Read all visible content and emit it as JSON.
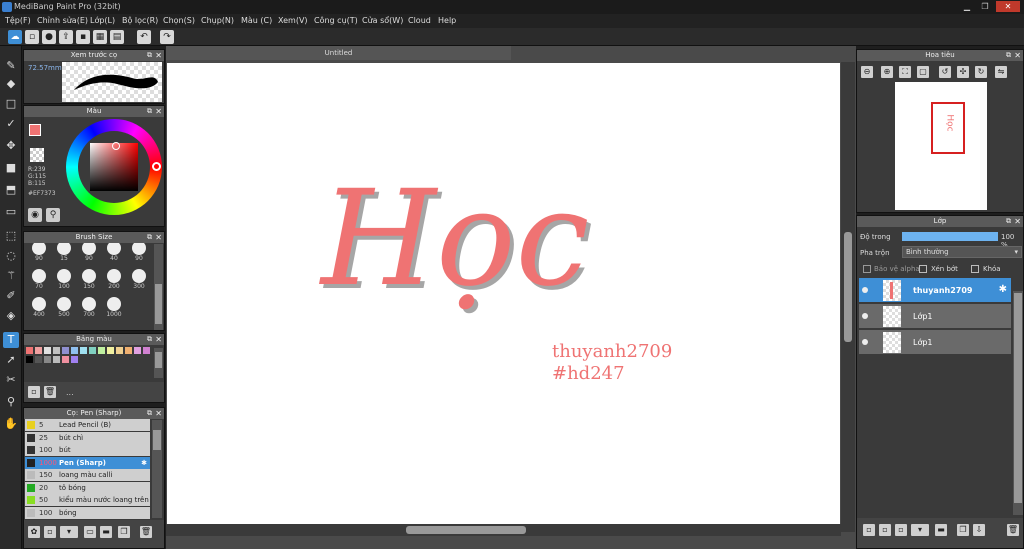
{
  "window": {
    "title": "MediBang Paint Pro (32bit)",
    "minimize": "▁",
    "maximize": "❐",
    "close": "✕"
  },
  "menu": [
    "Tệp(F)",
    "Chỉnh sửa(E)",
    "Lớp(L)",
    "Bộ lọc(R)",
    "Chọn(S)",
    "Chụp(N)",
    "Màu (C)",
    "Xem(V)",
    "Công cụ(T)",
    "Cửa sổ(W)",
    "Cloud",
    "Help"
  ],
  "toolbar": {
    "undo": "↶",
    "redo": "↷"
  },
  "preview_panel": {
    "title": "Xem trước cọ",
    "size": "72.57mm"
  },
  "color_panel": {
    "title": "Màu",
    "r": "R:239",
    "g": "G:115",
    "b": "B:115",
    "hex": "#EF7373",
    "primary_color": "#ef7373",
    "secondary_color": "#6a9de0"
  },
  "brush_size_panel": {
    "title": "Brush Size",
    "sizes": [
      "90",
      "15",
      "90",
      "40",
      "90",
      "70",
      "100",
      "150",
      "200",
      "300",
      "400",
      "500",
      "700",
      "1000"
    ]
  },
  "palette_panel": {
    "title": "Bảng màu",
    "more": "..."
  },
  "brush_panel": {
    "title": "Cọ: Pen (Sharp)",
    "items": [
      {
        "num": "5",
        "name": "Lead Pencil (B)",
        "color": "#e8d020"
      },
      {
        "num": "25",
        "name": "bút chì",
        "color": "#333333"
      },
      {
        "num": "100",
        "name": "bút",
        "color": "#333333"
      },
      {
        "num": "1000",
        "name": "Pen (Sharp)",
        "color": "#222222"
      },
      {
        "num": "150",
        "name": "loang màu calli",
        "color": "#bbbbbb"
      },
      {
        "num": "20",
        "name": "tô bóng",
        "color": "#22aa22"
      },
      {
        "num": "50",
        "name": "kiểu màu nước loang trên",
        "color": "#88dd22"
      },
      {
        "num": "100",
        "name": "bóng",
        "color": "#bbbbbb"
      }
    ]
  },
  "document": {
    "tab": "Untitled",
    "main_text": "Học",
    "sub1": "thuyanh2709",
    "sub2": "#hd247"
  },
  "navigator_panel": {
    "title": "Hoa tiêu"
  },
  "layer_panel": {
    "title": "Lớp",
    "opacity_label": "Độ trong",
    "opacity_value": "100 %",
    "blend_label": "Pha trộn",
    "blend_value": "Bình thường",
    "protect_alpha": "Bảo vệ alpha",
    "clipping": "Xén bớt",
    "lock": "Khóa",
    "layers": [
      {
        "name": "thuyanh2709"
      },
      {
        "name": "Lớp1"
      },
      {
        "name": "Lớp1"
      }
    ]
  }
}
